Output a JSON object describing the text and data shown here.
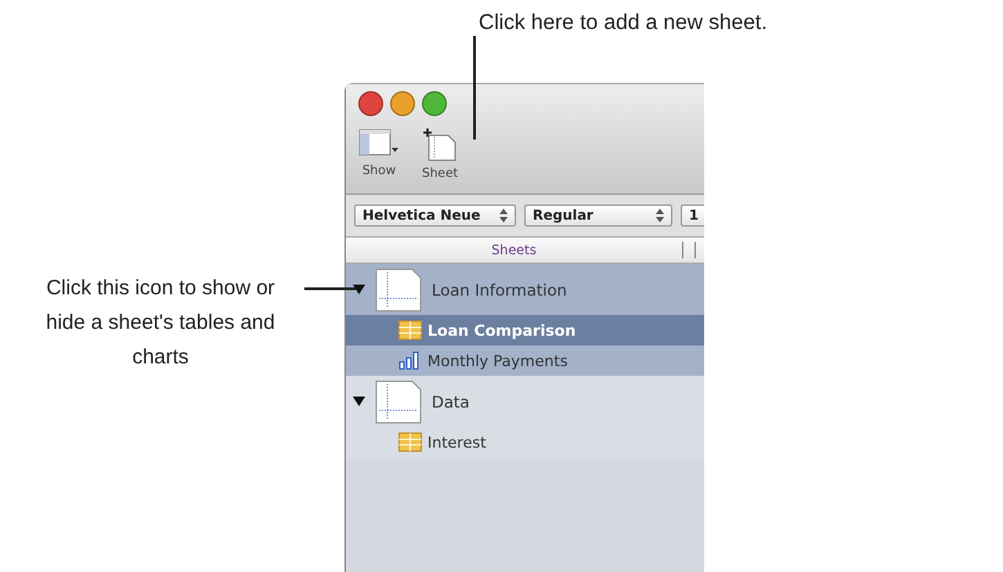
{
  "callouts": {
    "top": "Click here to add a new sheet.",
    "left": "Click this icon to show or hide a sheet's tables and charts"
  },
  "toolbar": {
    "buttons": [
      {
        "label": "Show",
        "kind": "show"
      },
      {
        "label": "Sheet",
        "kind": "sheet"
      }
    ]
  },
  "format_bar": {
    "font": "Helvetica Neue",
    "style": "Regular",
    "size": "1"
  },
  "sidebar": {
    "header": "Sheets",
    "sheets": [
      {
        "name": "Loan Information",
        "expanded": true,
        "selected": true,
        "children": [
          {
            "name": "Loan Comparison",
            "kind": "table",
            "selected": true
          },
          {
            "name": "Monthly Payments",
            "kind": "chart",
            "selected": false
          }
        ]
      },
      {
        "name": "Data",
        "expanded": true,
        "selected": false,
        "children": [
          {
            "name": "Interest",
            "kind": "table",
            "selected": false
          }
        ]
      }
    ]
  }
}
